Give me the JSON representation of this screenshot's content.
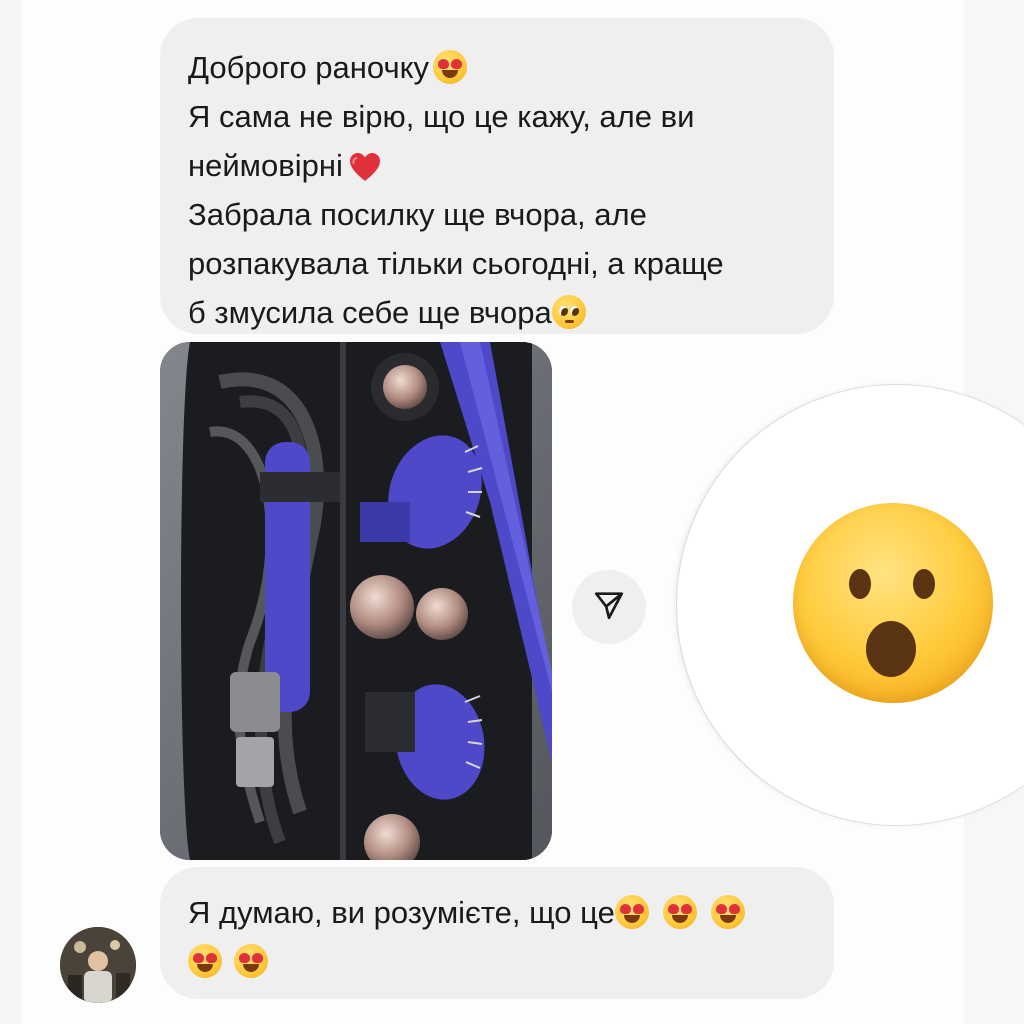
{
  "conversation": {
    "messages": [
      {
        "lines": [
          {
            "text": "Доброго раночку",
            "emoji": [
              "heart-eyes-emoji"
            ]
          },
          {
            "text": "Я сама не вірю, що це кажу, але ви"
          },
          {
            "text": "неймовірні",
            "emoji": [
              "red-heart-emoji"
            ]
          },
          {
            "text": "Забрала посилку ще вчора, але"
          },
          {
            "text": "розпакувала тільки сьогодні, а краще"
          },
          {
            "text": "б змусила себе ще вчора",
            "emoji": [
              "pleading-face-emoji"
            ]
          }
        ]
      },
      {
        "type": "photo",
        "description_icon": "photo-attachment"
      },
      {
        "lines": [
          {
            "text": "Я думаю, ви розумієте, що це",
            "emoji": [
              "heart-eyes-emoji",
              "heart-eyes-emoji",
              "heart-eyes-emoji"
            ]
          },
          {
            "text": "",
            "emoji": [
              "heart-eyes-emoji",
              "heart-eyes-emoji"
            ]
          }
        ]
      }
    ],
    "share_icon": "paper-plane-icon",
    "reaction_emoji": "astonished-face-emoji",
    "avatar_icon": "user-avatar"
  },
  "colors": {
    "bubble_bg": "#efefef",
    "text": "#1a1a1a",
    "emoji_yellow": "#ffcb3d",
    "heart_red": "#e0313b",
    "device_blue": "#4d49c9"
  }
}
